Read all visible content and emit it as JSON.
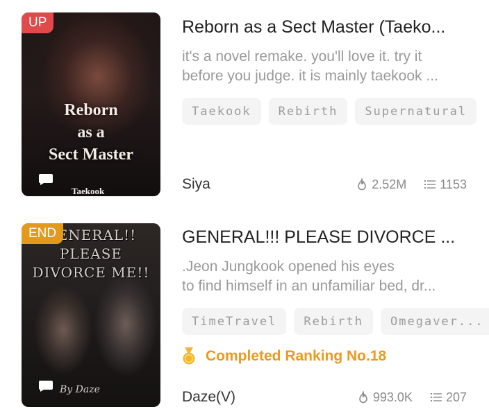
{
  "books": [
    {
      "badge": "UP",
      "cover_title": "Reborn\nas a\nSect Master",
      "cover_author": "Taekook",
      "title": "Reborn as a Sect Master (Taeko...",
      "desc_line1": "it's a novel remake. you'll love it. try it",
      "desc_line2": "before you judge. it is mainly taekook ...",
      "tags": [
        "Taekook",
        "Rebirth",
        "Supernatural"
      ],
      "author": "Siya",
      "views": "2.52M",
      "chapters": "1153"
    },
    {
      "badge": "END",
      "cover_title": "GENERAL!!\nPLEASE\nDIVORCE ME!!",
      "cover_author": "By Daze",
      "title": "GENERAL!!! PLEASE DIVORCE ...",
      "desc_line1": ".Jeon Jungkook opened his eyes",
      "desc_line2": "to find himself in an unfamiliar bed, dr...",
      "tags": [
        "TimeTravel",
        "Rebirth",
        "Omegaver..."
      ],
      "ranking": "Completed Ranking No.18",
      "author": "Daze(V)",
      "views": "993.0K",
      "chapters": "207"
    }
  ],
  "colors": {
    "up_badge": "#e04a4a",
    "end_badge": "#e39a1c",
    "ranking": "#ea9a1d"
  },
  "icons": {
    "views": "flame-icon",
    "chapters": "list-icon",
    "ranking": "medal-icon",
    "comment": "chat-bubble-icon"
  }
}
